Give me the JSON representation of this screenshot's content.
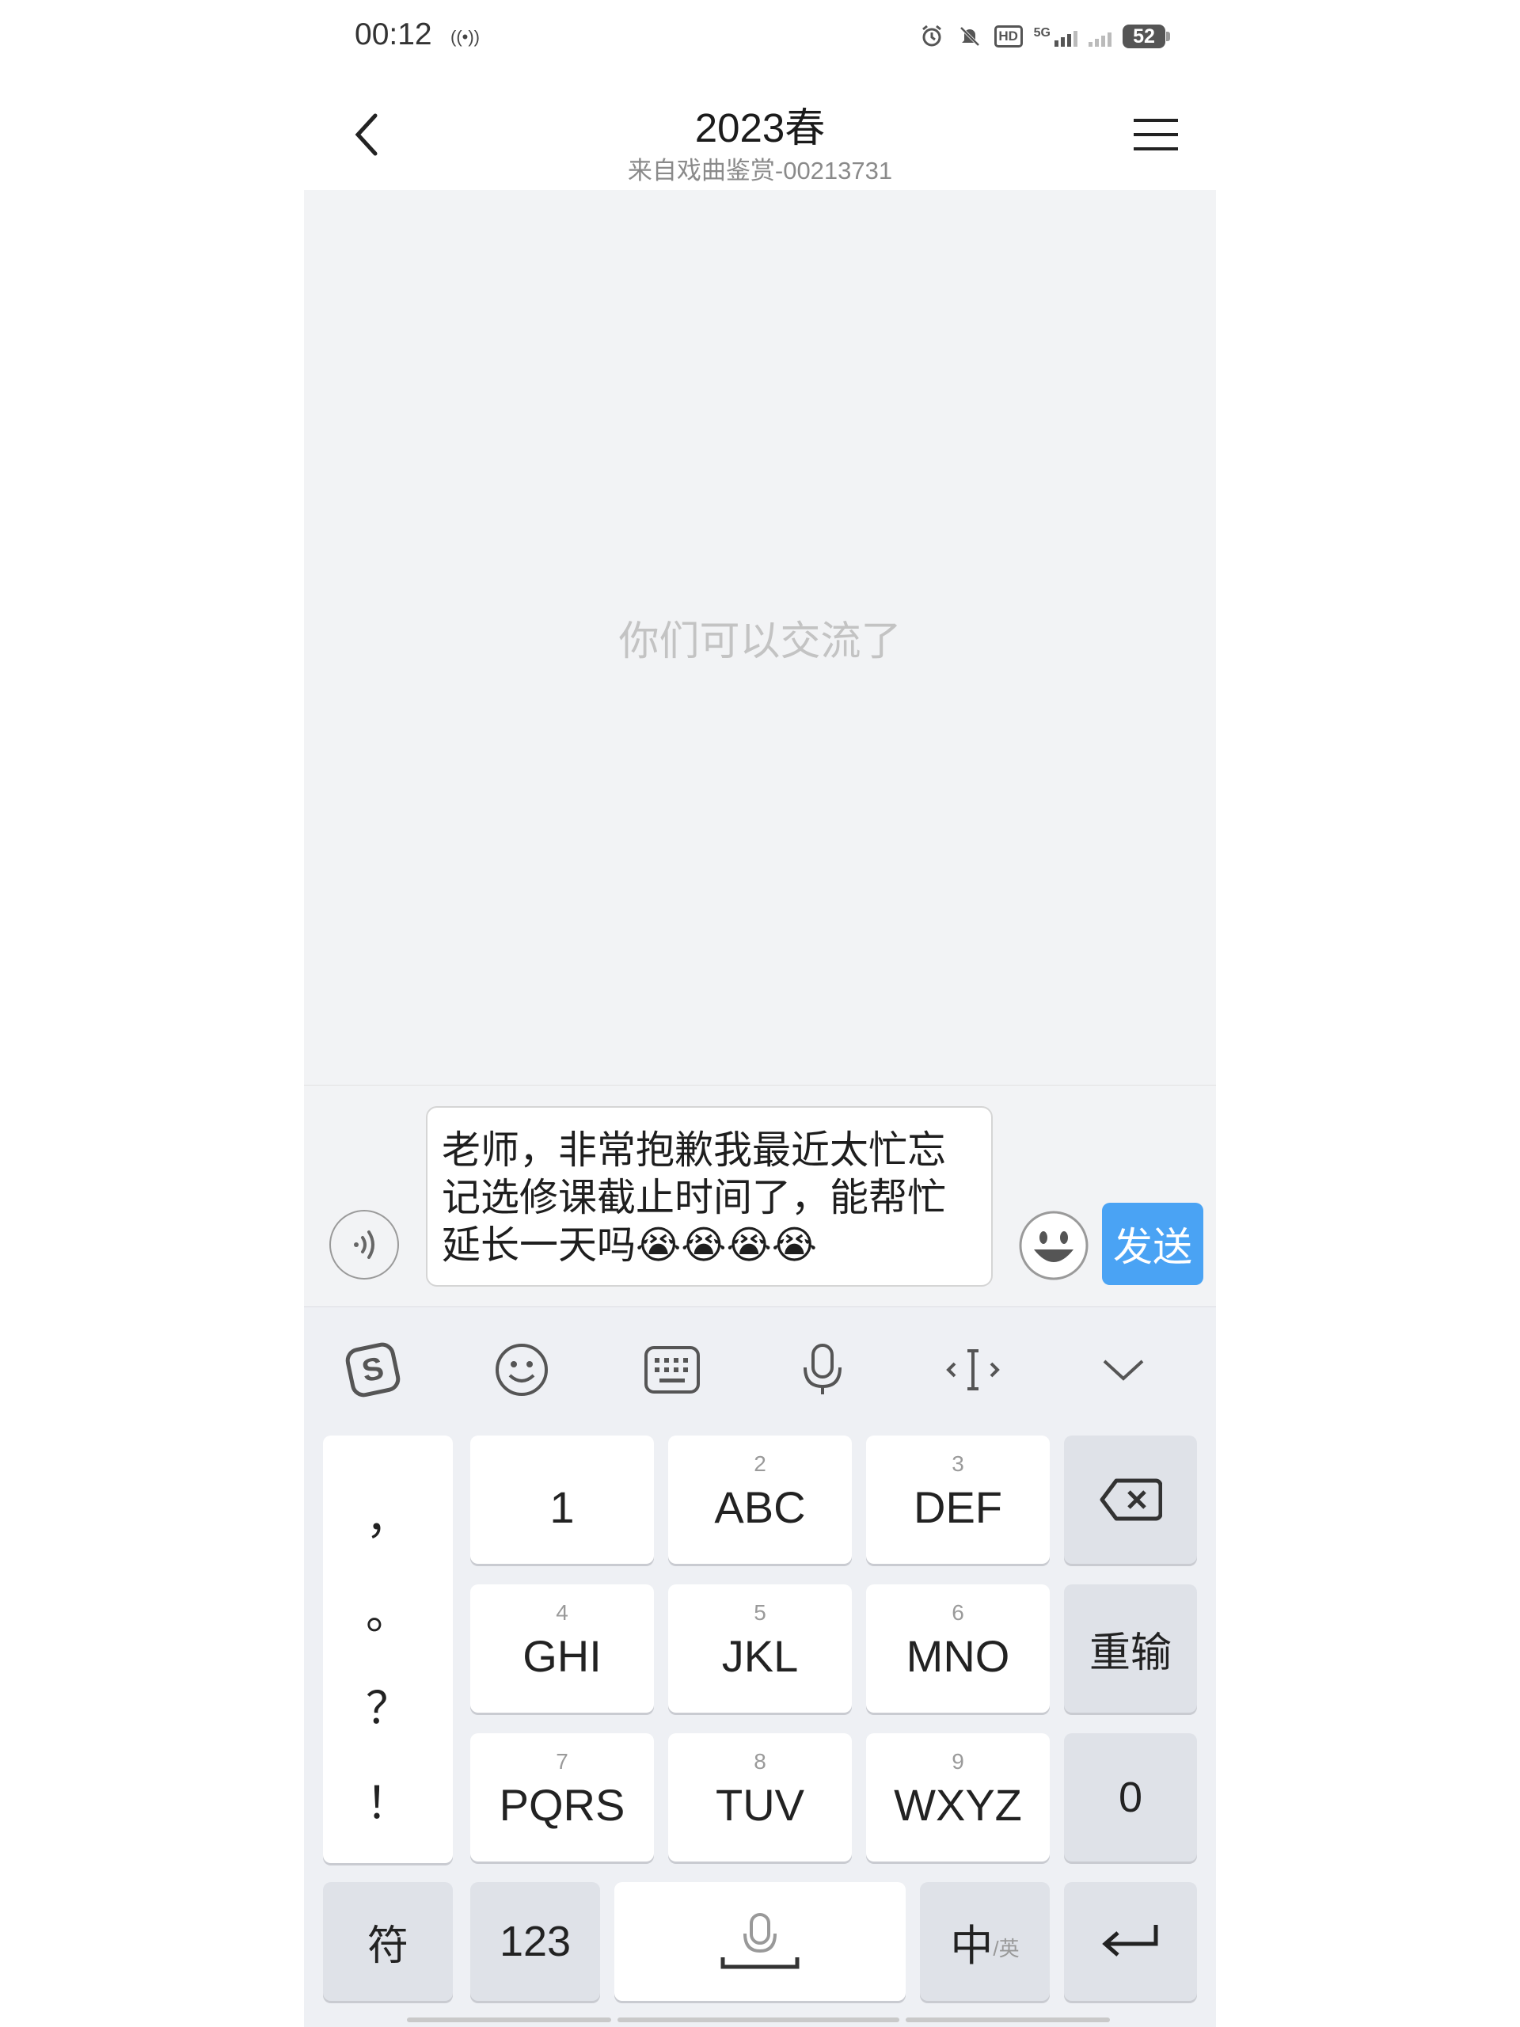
{
  "status_bar": {
    "time": "00:12",
    "battery": "52",
    "hd_label": "HD",
    "network": "5G"
  },
  "header": {
    "title": "2023春",
    "subtitle": "来自戏曲鉴赏-00213731"
  },
  "chat": {
    "empty_hint": "你们可以交流了"
  },
  "composer": {
    "message_text": "老师，非常抱歉我最近太忙忘记选修课截止时间了，能帮忙延长一天吗😭😭😭😭",
    "send_label": "发送"
  },
  "keyboard": {
    "toolbar": [
      "sogou-logo-icon",
      "emoji-icon",
      "keyboard-icon",
      "mic-icon",
      "cursor-icon",
      "collapse-icon"
    ],
    "punctuation": [
      "，",
      "。",
      "？",
      "！"
    ],
    "keys": [
      {
        "num": "",
        "label": "1"
      },
      {
        "num": "2",
        "label": "ABC"
      },
      {
        "num": "3",
        "label": "DEF"
      },
      {
        "num": "4",
        "label": "GHI"
      },
      {
        "num": "5",
        "label": "JKL"
      },
      {
        "num": "6",
        "label": "MNO"
      },
      {
        "num": "7",
        "label": "PQRS"
      },
      {
        "num": "8",
        "label": "TUV"
      },
      {
        "num": "9",
        "label": "WXYZ"
      }
    ],
    "reset_label": "重输",
    "zero_label": "0",
    "symbol_label": "符",
    "num_label": "123",
    "lang_main": "中",
    "lang_sub": "/英",
    "accent_color": "#4aa3f4"
  }
}
